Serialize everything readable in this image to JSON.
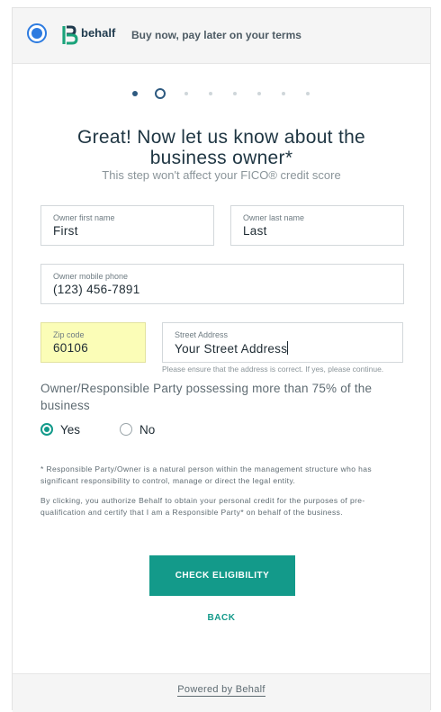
{
  "header": {
    "brand": "behalf",
    "tagline": "Buy now, pay later on your terms",
    "colors": {
      "brand_green": "#1aa37a",
      "brand_dark": "#1f3a4d",
      "radio_blue": "#2d7be0"
    }
  },
  "progress": {
    "total_steps": 8,
    "current_step": 2
  },
  "title_line1": "Great! Now let us know about the",
  "title_line2": "business owner*",
  "subtitle": "This step won't affect your FICO® credit score",
  "fields": {
    "first_name": {
      "label": "Owner first name",
      "value": "First"
    },
    "last_name": {
      "label": "Owner last name",
      "value": "Last"
    },
    "mobile": {
      "label": "Owner mobile phone",
      "value": "(123) 456-7891"
    },
    "zip": {
      "label": "Zip code",
      "value": "60106"
    },
    "street": {
      "label": "Street Address",
      "value": "Your Street Address"
    }
  },
  "address_hint": "Please ensure that the address is correct. If yes, please continue.",
  "question": "Owner/Responsible Party possessing more than 75% of the business",
  "options": {
    "yes": "Yes",
    "no": "No",
    "selected": "Yes"
  },
  "footnote": "* Responsible Party/Owner is a natural person within the management structure who has significant responsibility to control, manage or direct the legal entity.",
  "consent": "By clicking, you authorize Behalf to obtain your personal credit for the purposes of pre-qualification and certify that I am a Responsible Party* on behalf of the business.",
  "cta_label": "CHECK ELIGIBILITY",
  "back_label": "BACK",
  "footer": {
    "powered_by": "Powered by Behalf"
  },
  "accent_color": "#139a8a"
}
